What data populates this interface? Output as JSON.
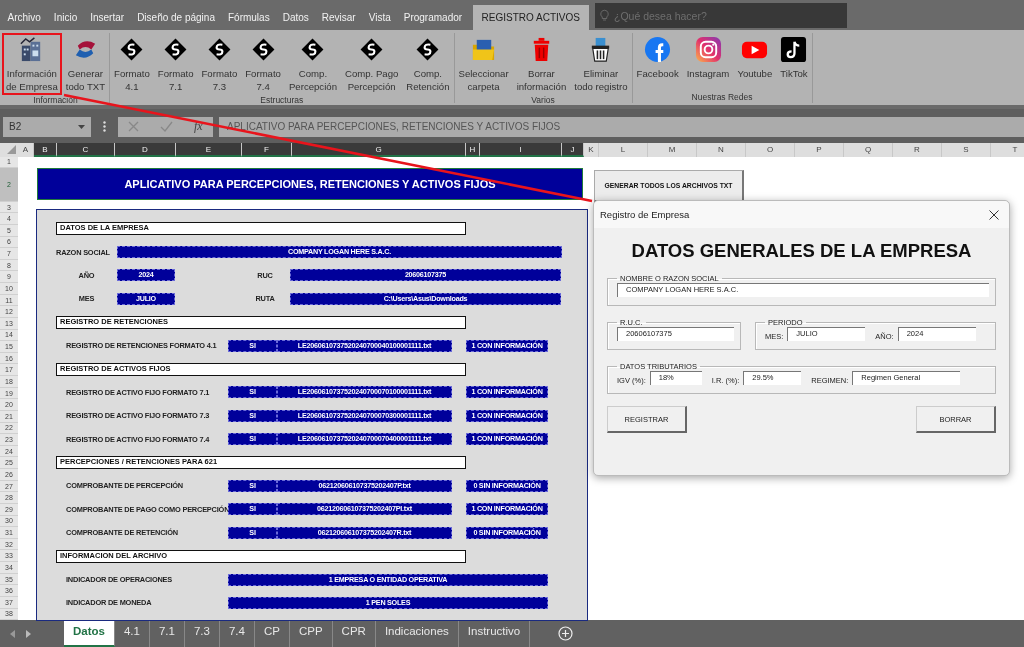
{
  "ribbon_tabs": [
    {
      "label": "Archivo",
      "selected": false
    },
    {
      "label": "Inicio",
      "selected": false
    },
    {
      "label": "Insertar",
      "selected": false
    },
    {
      "label": "Diseño de página",
      "selected": false
    },
    {
      "label": "Fórmulas",
      "selected": false
    },
    {
      "label": "Datos",
      "selected": false
    },
    {
      "label": "Revisar",
      "selected": false
    },
    {
      "label": "Vista",
      "selected": false
    },
    {
      "label": "Programador",
      "selected": false
    },
    {
      "label": "REGISTRO ACTIVOS",
      "selected": true
    }
  ],
  "search": {
    "placeholder": "¿Qué desea hacer?"
  },
  "ribbon_groups": [
    {
      "label": "Información",
      "buttons": [
        {
          "lines": [
            "Información",
            "de Empresa"
          ],
          "kind": "buildings",
          "highlighted": true
        },
        {
          "lines": [
            "Generar",
            "todo TXT"
          ],
          "kind": "swoosh",
          "highlighted": false
        }
      ]
    },
    {
      "label": "Estructuras",
      "buttons": [
        {
          "lines": [
            "Formato",
            "4.1"
          ],
          "kind": "diamond",
          "highlighted": false
        },
        {
          "lines": [
            "Formato",
            "7.1"
          ],
          "kind": "diamond",
          "highlighted": false
        },
        {
          "lines": [
            "Formato",
            "7.3"
          ],
          "kind": "diamond",
          "highlighted": false
        },
        {
          "lines": [
            "Formato",
            "7.4"
          ],
          "kind": "diamond",
          "highlighted": false
        },
        {
          "lines": [
            "Comp.",
            "Percepción"
          ],
          "kind": "diamond",
          "highlighted": false
        },
        {
          "lines": [
            "Comp. Pago",
            "Percepción"
          ],
          "kind": "diamond",
          "highlighted": false
        },
        {
          "lines": [
            "Comp.",
            "Retención"
          ],
          "kind": "diamond",
          "highlighted": false
        }
      ]
    },
    {
      "label": "Varios",
      "buttons": [
        {
          "lines": [
            "Seleccionar",
            "carpeta"
          ],
          "kind": "folder",
          "highlighted": false
        },
        {
          "lines": [
            "Borrar",
            "información"
          ],
          "kind": "trash",
          "highlighted": false
        },
        {
          "lines": [
            "Eliminar",
            "todo registro"
          ],
          "kind": "trash_docs",
          "highlighted": false
        }
      ]
    },
    {
      "label": "Nuestras Redes",
      "buttons": [
        {
          "lines": [
            "Facebook"
          ],
          "kind": "facebook",
          "highlighted": false
        },
        {
          "lines": [
            "Instagram"
          ],
          "kind": "instagram",
          "highlighted": false
        },
        {
          "lines": [
            "Youtube"
          ],
          "kind": "youtube",
          "highlighted": false
        },
        {
          "lines": [
            "TikTok"
          ],
          "kind": "tiktok",
          "highlighted": false
        }
      ]
    }
  ],
  "formula_bar": {
    "name_box": "B2",
    "fx": "fx",
    "content": "APLICATIVO PARA PERCEPCIONES, RETENCIONES Y ACTIVOS FIJOS"
  },
  "columns": [
    {
      "label": "A",
      "selected": false
    },
    {
      "label": "B",
      "selected": true
    },
    {
      "label": "C",
      "selected": true
    },
    {
      "label": "D",
      "selected": true
    },
    {
      "label": "E",
      "selected": true
    },
    {
      "label": "F",
      "selected": true
    },
    {
      "label": "G",
      "selected": true
    },
    {
      "label": "H",
      "selected": true
    },
    {
      "label": "I",
      "selected": true
    },
    {
      "label": "J",
      "selected": true
    },
    {
      "label": "K",
      "selected": false
    },
    {
      "label": "L",
      "selected": false
    },
    {
      "label": "M",
      "selected": false
    },
    {
      "label": "N",
      "selected": false
    },
    {
      "label": "O",
      "selected": false
    },
    {
      "label": "P",
      "selected": false
    },
    {
      "label": "Q",
      "selected": false
    },
    {
      "label": "R",
      "selected": false
    },
    {
      "label": "S",
      "selected": false
    },
    {
      "label": "T",
      "selected": false
    }
  ],
  "rows": [
    {
      "label": "1",
      "selected": false
    },
    {
      "label": "2",
      "selected": true
    },
    {
      "label": "3",
      "selected": false
    },
    {
      "label": "4",
      "selected": false
    },
    {
      "label": "5",
      "selected": false
    },
    {
      "label": "6",
      "selected": false
    },
    {
      "label": "7",
      "selected": false
    },
    {
      "label": "8",
      "selected": false
    },
    {
      "label": "9",
      "selected": false
    },
    {
      "label": "10",
      "selected": false
    },
    {
      "label": "11",
      "selected": false
    },
    {
      "label": "12",
      "selected": false
    },
    {
      "label": "13",
      "selected": false
    },
    {
      "label": "14",
      "selected": false
    },
    {
      "label": "15",
      "selected": false
    },
    {
      "label": "16",
      "selected": false
    },
    {
      "label": "17",
      "selected": false
    },
    {
      "label": "18",
      "selected": false
    },
    {
      "label": "19",
      "selected": false
    },
    {
      "label": "20",
      "selected": false
    },
    {
      "label": "21",
      "selected": false
    },
    {
      "label": "22",
      "selected": false
    },
    {
      "label": "23",
      "selected": false
    },
    {
      "label": "24",
      "selected": false
    },
    {
      "label": "25",
      "selected": false
    },
    {
      "label": "26",
      "selected": false
    },
    {
      "label": "27",
      "selected": false
    },
    {
      "label": "28",
      "selected": false
    },
    {
      "label": "29",
      "selected": false
    },
    {
      "label": "30",
      "selected": false
    },
    {
      "label": "31",
      "selected": false
    },
    {
      "label": "32",
      "selected": false
    },
    {
      "label": "33",
      "selected": false
    },
    {
      "label": "34",
      "selected": false
    },
    {
      "label": "35",
      "selected": false
    },
    {
      "label": "36",
      "selected": false
    },
    {
      "label": "37",
      "selected": false
    },
    {
      "label": "38",
      "selected": false
    }
  ],
  "sheet": {
    "title": "APLICATIVO PARA PERCEPCIONES, RETENCIONES Y ACTIVOS FIJOS",
    "generate_button": "GENERAR TODOS LOS ARCHIVOS TXT",
    "lines": [
      {
        "kind": "section",
        "title": "DATOS DE LA EMPRESA"
      },
      {
        "kind": "field",
        "label": "RAZON SOCIAL",
        "value": "COMPANY LOGAN HERE S.A.C."
      },
      {
        "kind": "pair",
        "label": "AÑO",
        "value": "2024",
        "label_2": "RUC",
        "value_2": "20606107375"
      },
      {
        "kind": "pair",
        "label": "MES",
        "value": "JULIO",
        "label_2": "RUTA",
        "value_2": "C:\\Users\\Asus\\Downloads"
      },
      {
        "kind": "section",
        "title": "REGISTRO DE RETENCIONES"
      },
      {
        "kind": "file",
        "label": "REGISTRO DE RETENCIONES FORMATO 4.1",
        "flag": "SI",
        "file": "LE2060610737520240700040100001111.txt",
        "status": "1 CON INFORMACIÓN"
      },
      {
        "kind": "section",
        "title": "REGISTRO DE ACTIVOS FIJOS"
      },
      {
        "kind": "file",
        "label": "REGISTRO DE ACTIVO FIJO FORMATO 7.1",
        "flag": "SI",
        "file": "LE2060610737520240700070100001111.txt",
        "status": "1 CON INFORMACIÓN"
      },
      {
        "kind": "file",
        "label": "REGISTRO DE ACTIVO FIJO FORMATO 7.3",
        "flag": "SI",
        "file": "LE2060610737520240700070300001111.txt",
        "status": "1 CON INFORMACIÓN"
      },
      {
        "kind": "file",
        "label": "REGISTRO DE ACTIVO FIJO FORMATO 7.4",
        "flag": "SI",
        "file": "LE2060610737520240700070400001111.txt",
        "status": "1 CON INFORMACIÓN"
      },
      {
        "kind": "section",
        "title": "PERCEPCIONES / RETENCIONES PARA 621"
      },
      {
        "kind": "file",
        "label": "COMPROBANTE DE PERCEPCIÓN",
        "flag": "SI",
        "file": "062120606107375202407P.txt",
        "status": "0 SIN INFORMACIÓN"
      },
      {
        "kind": "file",
        "label": "COMPROBANTE DE PAGO COMO PERCEPCIÓN",
        "flag": "SI",
        "file": "062120606107375202407PI.txt",
        "status": "1 CON INFORMACIÓN"
      },
      {
        "kind": "file",
        "label": "COMPROBANTE DE RETENCIÓN",
        "flag": "SI",
        "file": "062120606107375202407R.txt",
        "status": "0 SIN INFORMACIÓN"
      },
      {
        "kind": "section",
        "title": "INFORMACION DEL ARCHIVO"
      },
      {
        "kind": "indicator",
        "label": "INDICADOR DE OPERACIONES",
        "value": "1 EMPRESA O ENTIDAD OPERATIVA"
      },
      {
        "kind": "indicator",
        "label": "INDICADOR DE MONEDA",
        "value": "1 PEN SOLES"
      }
    ]
  },
  "dialog": {
    "title": "Registro de Empresa",
    "heading": "DATOS GENERALES DE LA EMPRESA",
    "name_group": {
      "legend": "NOMBRE O RAZON SOCIAL",
      "value": "COMPANY LOGAN HERE S.A.C."
    },
    "ruc_group": {
      "legend": "R.U.C.",
      "value": "20606107375"
    },
    "period_group": {
      "legend": "PERIODO",
      "month_label": "MES:",
      "month": "JULIO",
      "year_label": "AÑO:",
      "year": "2024"
    },
    "tax_group": {
      "legend": "DATOS TRIBUTARIOS",
      "igv_label": "IGV (%):",
      "igv": "18%",
      "ir_label": "I.R. (%):",
      "ir": "29.5%",
      "regime_label": "REGIMEN:",
      "regime": "Regimen General"
    },
    "buttons": [
      "REGISTRAR",
      "BORRAR"
    ]
  },
  "sheet_tabs": [
    {
      "label": "Datos",
      "selected": true
    },
    {
      "label": "4.1",
      "selected": false
    },
    {
      "label": "7.1",
      "selected": false
    },
    {
      "label": "7.3",
      "selected": false
    },
    {
      "label": "7.4",
      "selected": false
    },
    {
      "label": "CP",
      "selected": false
    },
    {
      "label": "CPP",
      "selected": false
    },
    {
      "label": "CPR",
      "selected": false
    },
    {
      "label": "Indicaciones",
      "selected": false
    },
    {
      "label": "Instructivo",
      "selected": false
    }
  ]
}
